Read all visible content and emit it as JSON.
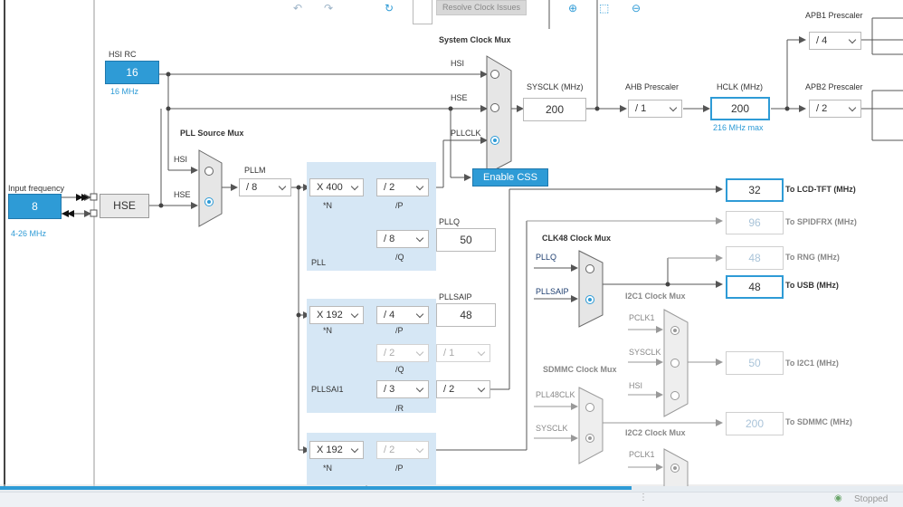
{
  "toolbar": {
    "resolve_label": "Resolve Clock Issues"
  },
  "hsi_rc": {
    "title": "HSI RC",
    "value": "16",
    "freq": "16 MHz"
  },
  "input": {
    "label": "Input frequency",
    "value": "8",
    "range": "4-26 MHz",
    "hse_label": "HSE"
  },
  "pll_source_mux": {
    "title": "PLL Source Mux",
    "hsi": "HSI",
    "hse": "HSE"
  },
  "system_clock_mux": {
    "title": "System Clock Mux",
    "hsi": "HSI",
    "hse": "HSE",
    "pllclk": "PLLCLK",
    "enable_css": "Enable CSS"
  },
  "sysclk": {
    "label": "SYSCLK (MHz)",
    "value": "200"
  },
  "ahb": {
    "label": "AHB Prescaler",
    "value": "/ 1"
  },
  "hclk": {
    "label": "HCLK (MHz)",
    "value": "200",
    "max": "216 MHz max"
  },
  "apb2": {
    "label": "APB2 Prescaler",
    "value": "/ 2"
  },
  "apb1": {
    "label": "APB1 Prescaler",
    "value": "/ 4"
  },
  "pllm": {
    "label": "PLLM",
    "value": "/ 8"
  },
  "pll": {
    "name": "PLL",
    "n_value": "X 400",
    "n_label": "*N",
    "p_value": "/ 2",
    "p_label": "/P",
    "q_value": "/ 8",
    "q_label": "/Q",
    "pllq_label": "PLLQ",
    "pllq_value": "50"
  },
  "pllsai": {
    "name": "PLLSAI1",
    "n_value": "X 192",
    "n_label": "*N",
    "p_value": "/ 4",
    "p_label": "/P",
    "q_value": "/ 2",
    "q_label": "/Q",
    "q_div_value": "/ 1",
    "r_value": "/ 3",
    "r_label": "/R",
    "r_div_value": "/ 2",
    "pllsaip_label": "PLLSAIP",
    "pllsaip_value": "48"
  },
  "plli2s": {
    "n_value": "X 192",
    "n_label": "*N",
    "p_value": "/ 2",
    "p_label": "/P"
  },
  "outputs": {
    "lcd": {
      "value": "32",
      "label": "To LCD-TFT (MHz)"
    },
    "spidfrx": {
      "value": "96",
      "label": "To SPIDFRX (MHz)"
    },
    "rng": {
      "value": "48",
      "label": "To RNG (MHz)"
    },
    "usb": {
      "value": "48",
      "label": "To USB (MHz)"
    },
    "i2c1": {
      "value": "50",
      "label": "To I2C1 (MHz)"
    },
    "sdmmc": {
      "value": "200",
      "label": "To SDMMC (MHz)"
    }
  },
  "clk48_mux": {
    "title": "CLK48 Clock Mux",
    "pllq": "PLLQ",
    "pllsaip": "PLLSAIP"
  },
  "i2c1_mux": {
    "title": "I2C1 Clock Mux",
    "pclk1": "PCLK1",
    "sysclk": "SYSCLK",
    "hsi": "HSI"
  },
  "sdmmc_mux": {
    "title": "SDMMC Clock Mux",
    "pll48clk": "PLL48CLK",
    "sysclk": "SYSCLK"
  },
  "i2c2_mux": {
    "title": "I2C2 Clock Mux",
    "pclk1": "PCLK1"
  },
  "status": {
    "text": "Stopped"
  }
}
